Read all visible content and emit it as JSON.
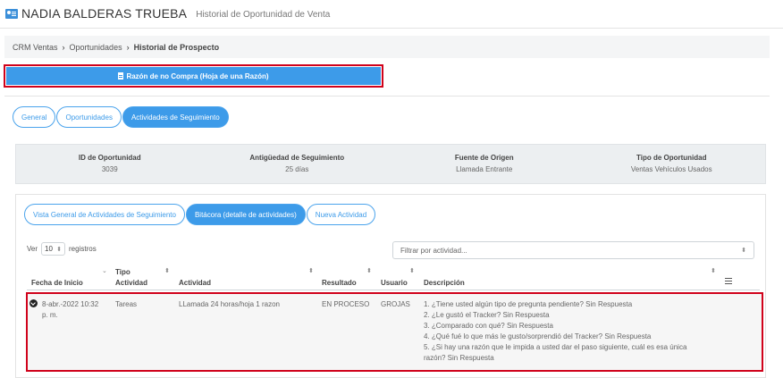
{
  "header": {
    "name": "NADIA BALDERAS TRUEBA",
    "subtitle": "Historial de Oportunidad de Venta"
  },
  "breadcrumb": {
    "items": [
      "CRM Ventas",
      "Oportunidades"
    ],
    "current": "Historial de Prospecto"
  },
  "main_button": {
    "label": "Razón de no Compra (Hoja de una Razón)"
  },
  "top_tabs": [
    {
      "label": "General",
      "active": false
    },
    {
      "label": "Oportunidades",
      "active": false
    },
    {
      "label": "Actividades de Seguimiento",
      "active": true
    }
  ],
  "summary": [
    {
      "label": "ID de Oportunidad",
      "value": "3039"
    },
    {
      "label": "Antigüedad de Seguimiento",
      "value": "25 días"
    },
    {
      "label": "Fuente de Origen",
      "value": "Llamada Entrante"
    },
    {
      "label": "Tipo de Oportunidad",
      "value": "Ventas Vehículos Usados"
    }
  ],
  "sub_tabs": [
    {
      "label": "Vista General de Actividades de Seguimiento",
      "active": false
    },
    {
      "label": "Bitácora (detalle de actividades)",
      "active": true
    },
    {
      "label": "Nueva Actividad",
      "active": false
    }
  ],
  "entries": {
    "prefix": "Ver",
    "value": "10",
    "suffix": "registros"
  },
  "filter": {
    "placeholder": "Filtrar por actividad..."
  },
  "table": {
    "columns": {
      "fecha": "Fecha de Inicio",
      "tipo_line1": "Tipo",
      "tipo_line2": "Actividad",
      "actividad": "Actividad",
      "resultado": "Resultado",
      "usuario": "Usuario",
      "descripcion": "Descripción"
    },
    "rows": [
      {
        "fecha_line1": "8-abr.-2022 10:32",
        "fecha_line2": "p. m.",
        "tipo": "Tareas",
        "actividad": "LLamada 24 horas/hoja 1 razon",
        "resultado": "EN PROCESO",
        "usuario": "GROJAS",
        "descripcion": [
          "1. ¿Tiene usted algún tipo de pregunta pendiente? Sin Respuesta",
          "2. ¿Le gustó el Tracker? Sin Respuesta",
          "3. ¿Comparado con qué? Sin Respuesta",
          "4. ¿Qué fué lo que más le gusto/sorprendió del Tracker? Sin Respuesta",
          "5. ¿Si hay una razón que le impida a usted dar el paso siguiente, cuál es esa única",
          "razón? Sin Respuesta"
        ]
      }
    ]
  },
  "icons": {
    "header_icon": "id-card-icon",
    "button_icon": "document-icon",
    "row_icon": "expand-circle-icon",
    "menu_icon": "column-menu-icon"
  },
  "colors": {
    "accent": "#3d9be9",
    "highlight_outline": "#d0021b"
  }
}
